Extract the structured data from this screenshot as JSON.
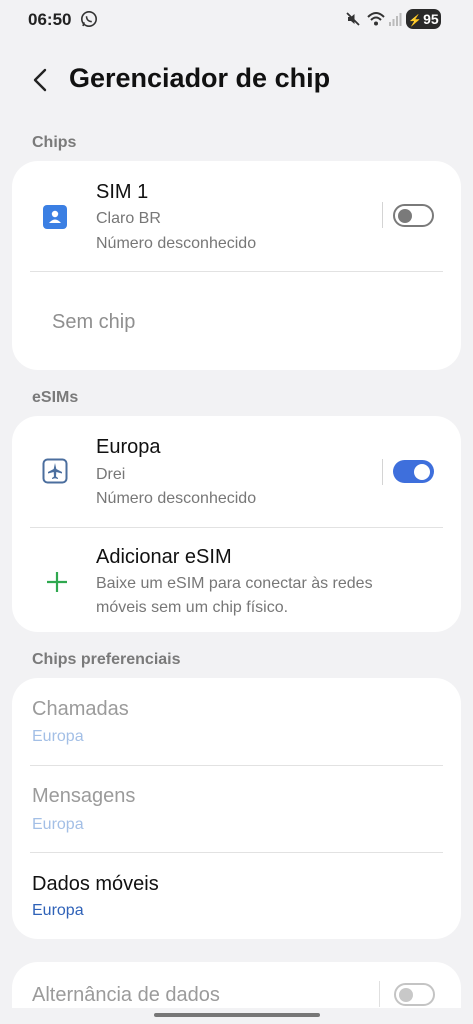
{
  "status_bar": {
    "time": "06:50",
    "battery": "95",
    "icons": [
      "whatsapp-icon",
      "mute-icon",
      "wifi-icon",
      "signal-icon",
      "battery-icon"
    ]
  },
  "header": {
    "title": "Gerenciador de chip"
  },
  "chips": {
    "label": "Chips",
    "sim1": {
      "name": "SIM 1",
      "carrier": "Claro BR",
      "number": "Número desconhecido",
      "enabled": false
    },
    "empty_slot": "Sem chip"
  },
  "esims": {
    "label": "eSIMs",
    "europa": {
      "name": "Europa",
      "carrier": "Drei",
      "number": "Número desconhecido",
      "enabled": true
    },
    "add": {
      "title": "Adicionar eSIM",
      "description_line1": "Baixe um eSIM para conectar às redes",
      "description_line2": "móveis sem um chip físico."
    }
  },
  "preferred": {
    "label": "Chips preferenciais",
    "calls": {
      "title": "Chamadas",
      "value": "Europa"
    },
    "messages": {
      "title": "Mensagens",
      "value": "Europa"
    },
    "mobile_data": {
      "title": "Dados móveis",
      "value": "Europa"
    }
  },
  "data_switch": {
    "title": "Alternância de dados",
    "enabled": false
  },
  "colors": {
    "accent": "#3e6fdc",
    "background": "#f2f2f4",
    "card": "#ffffff",
    "add_icon": "#2fa84f",
    "sim_icon": "#3b7fe3"
  }
}
